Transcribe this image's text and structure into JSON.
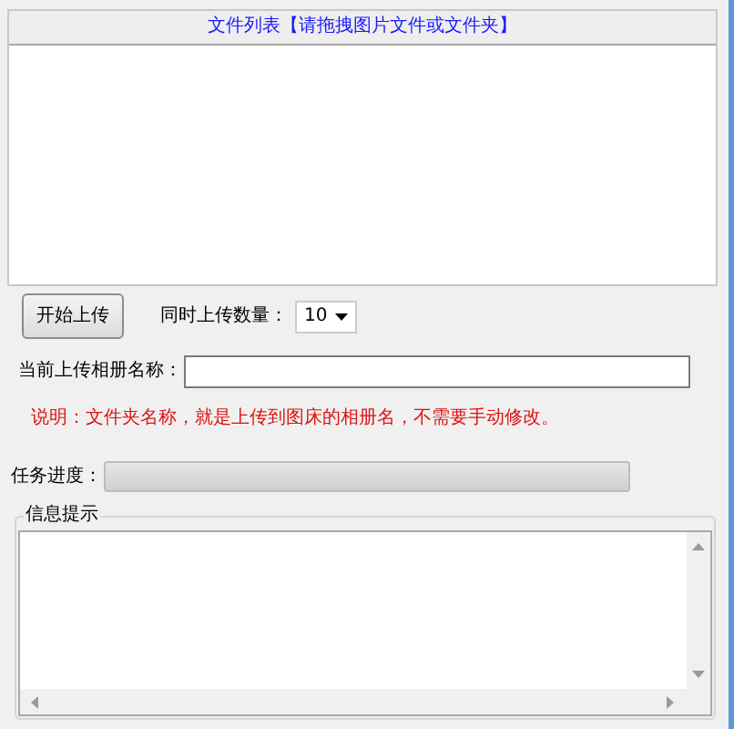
{
  "file_list": {
    "title": "文件列表【请拖拽图片文件或文件夹】"
  },
  "start_button": {
    "label": "开始上传"
  },
  "concurrency": {
    "label": "同时上传数量：",
    "value": "10"
  },
  "album": {
    "label": "当前上传相册名称："
  },
  "note": "说明：文件夹名称，就是上传到图床的相册名，不需要手动修改。",
  "progress": {
    "label": "任务进度：",
    "level": 0
  },
  "info": {
    "title": "信息提示"
  }
}
